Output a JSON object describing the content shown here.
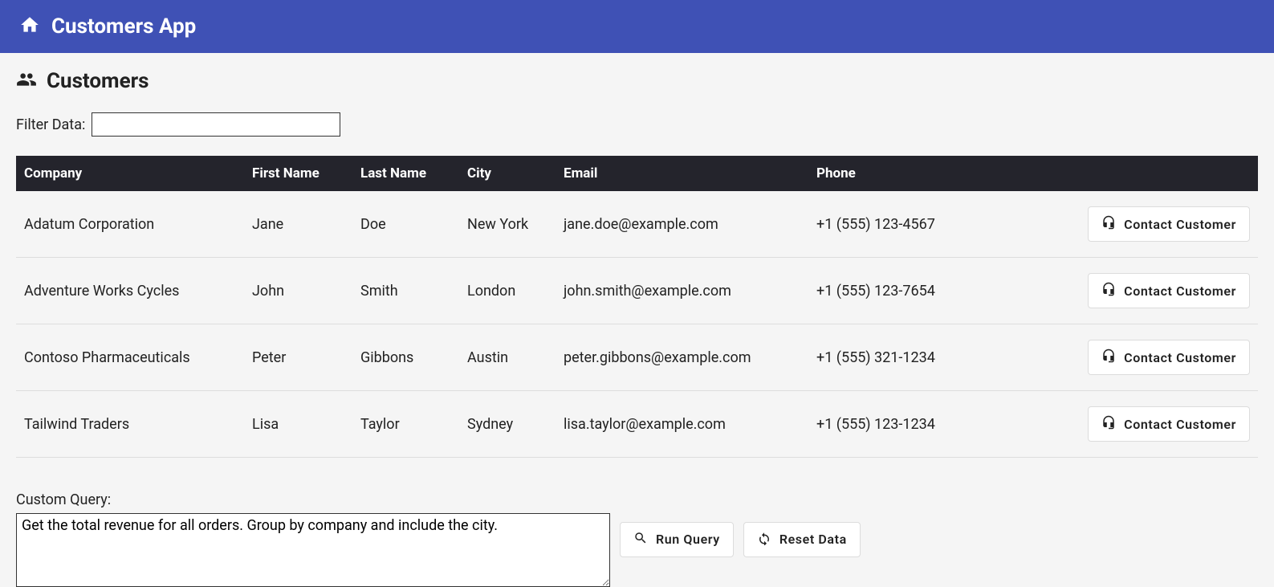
{
  "header": {
    "title": "Customers App"
  },
  "page": {
    "heading": "Customers"
  },
  "filter": {
    "label": "Filter Data:",
    "value": ""
  },
  "table": {
    "columns": [
      "Company",
      "First Name",
      "Last Name",
      "City",
      "Email",
      "Phone"
    ],
    "rows": [
      {
        "company": "Adatum Corporation",
        "first": "Jane",
        "last": "Doe",
        "city": "New York",
        "email": "jane.doe@example.com",
        "phone": "+1 (555) 123-4567"
      },
      {
        "company": "Adventure Works Cycles",
        "first": "John",
        "last": "Smith",
        "city": "London",
        "email": "john.smith@example.com",
        "phone": "+1 (555) 123-7654"
      },
      {
        "company": "Contoso Pharmaceuticals",
        "first": "Peter",
        "last": "Gibbons",
        "city": "Austin",
        "email": "peter.gibbons@example.com",
        "phone": "+1 (555) 321-1234"
      },
      {
        "company": "Tailwind Traders",
        "first": "Lisa",
        "last": "Taylor",
        "city": "Sydney",
        "email": "lisa.taylor@example.com",
        "phone": "+1 (555) 123-1234"
      }
    ],
    "action_label": "Contact Customer"
  },
  "query": {
    "label": "Custom Query:",
    "value": "Get the total revenue for all orders. Group by company and include the city.",
    "run_label": "Run Query",
    "reset_label": "Reset Data"
  }
}
